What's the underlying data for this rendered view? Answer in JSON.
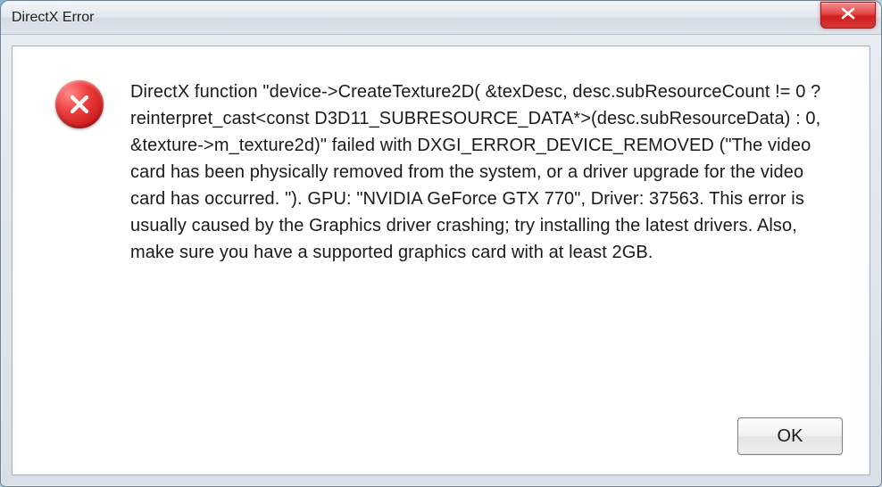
{
  "window": {
    "title": "DirectX Error"
  },
  "dialog": {
    "message": "DirectX function \"device->CreateTexture2D( &texDesc, desc.subResourceCount != 0 ? reinterpret_cast<const D3D11_SUBRESOURCE_DATA*>(desc.subResourceData) : 0, &texture->m_texture2d)\" failed with DXGI_ERROR_DEVICE_REMOVED (\"The video card has been physically removed from the system, or a driver upgrade for the video card has occurred. \"). GPU: \"NVIDIA GeForce GTX 770\", Driver: 37563. This error is usually caused by the Graphics driver crashing; try installing the latest drivers. Also, make sure you have a supported graphics card with at least 2GB.",
    "ok_label": "OK"
  }
}
